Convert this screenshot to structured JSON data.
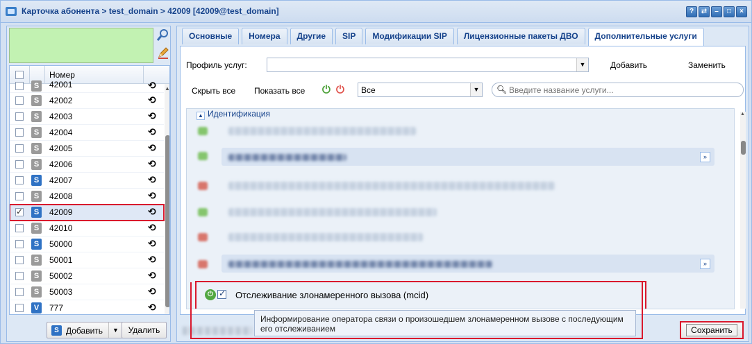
{
  "window": {
    "title": "Карточка абонента > test_domain > 42009 [42009@test_domain]",
    "tools": [
      "?",
      "⇄",
      "–",
      "□",
      "×"
    ]
  },
  "left": {
    "column_header": "Номер",
    "rows": [
      {
        "number": "42001",
        "type": "S",
        "checked": false,
        "selected": false
      },
      {
        "number": "42002",
        "type": "S",
        "checked": false,
        "selected": false
      },
      {
        "number": "42003",
        "type": "S",
        "checked": false,
        "selected": false
      },
      {
        "number": "42004",
        "type": "S",
        "checked": false,
        "selected": false
      },
      {
        "number": "42005",
        "type": "S",
        "checked": false,
        "selected": false
      },
      {
        "number": "42006",
        "type": "S",
        "checked": false,
        "selected": false
      },
      {
        "number": "42007",
        "type": "S",
        "checked": false,
        "selected": false
      },
      {
        "number": "42008",
        "type": "S",
        "checked": false,
        "selected": false
      },
      {
        "number": "42009",
        "type": "S",
        "checked": true,
        "selected": true
      },
      {
        "number": "42010",
        "type": "S",
        "checked": false,
        "selected": false
      },
      {
        "number": "50000",
        "type": "S",
        "checked": false,
        "selected": false
      },
      {
        "number": "50001",
        "type": "S",
        "checked": false,
        "selected": false
      },
      {
        "number": "50002",
        "type": "S",
        "checked": false,
        "selected": false
      },
      {
        "number": "50003",
        "type": "S",
        "checked": false,
        "selected": false
      },
      {
        "number": "777",
        "type": "V",
        "checked": false,
        "selected": false
      }
    ],
    "add_label": "Добавить",
    "delete_label": "Удалить"
  },
  "tabs": [
    {
      "label": "Основные",
      "active": false
    },
    {
      "label": "Номера",
      "active": false
    },
    {
      "label": "Другие",
      "active": false
    },
    {
      "label": "SIP",
      "active": false
    },
    {
      "label": "Модификации SIP",
      "active": false
    },
    {
      "label": "Лицензионные пакеты ДВО",
      "active": false
    },
    {
      "label": "Дополнительные услуги",
      "active": true
    }
  ],
  "services": {
    "profile_label": "Профиль услуг:",
    "profile_value": "",
    "add_label": "Добавить",
    "replace_label": "Заменить",
    "hide_all_label": "Скрыть все",
    "show_all_label": "Показать все",
    "filter_value": "Все",
    "search_placeholder": "Введите название услуги...",
    "group_title": "Идентификация",
    "mcid_label": "Отслеживание злонамеренного вызова (mcid)",
    "tooltip": "Информирование оператора связи о произошедшем злонамеренном вызове с последующим его отслеживанием",
    "save_label": "Сохранить"
  },
  "colors": {
    "accent": "#15428b",
    "highlight": "#d9182d",
    "green_panel": "#c2f2b2"
  }
}
